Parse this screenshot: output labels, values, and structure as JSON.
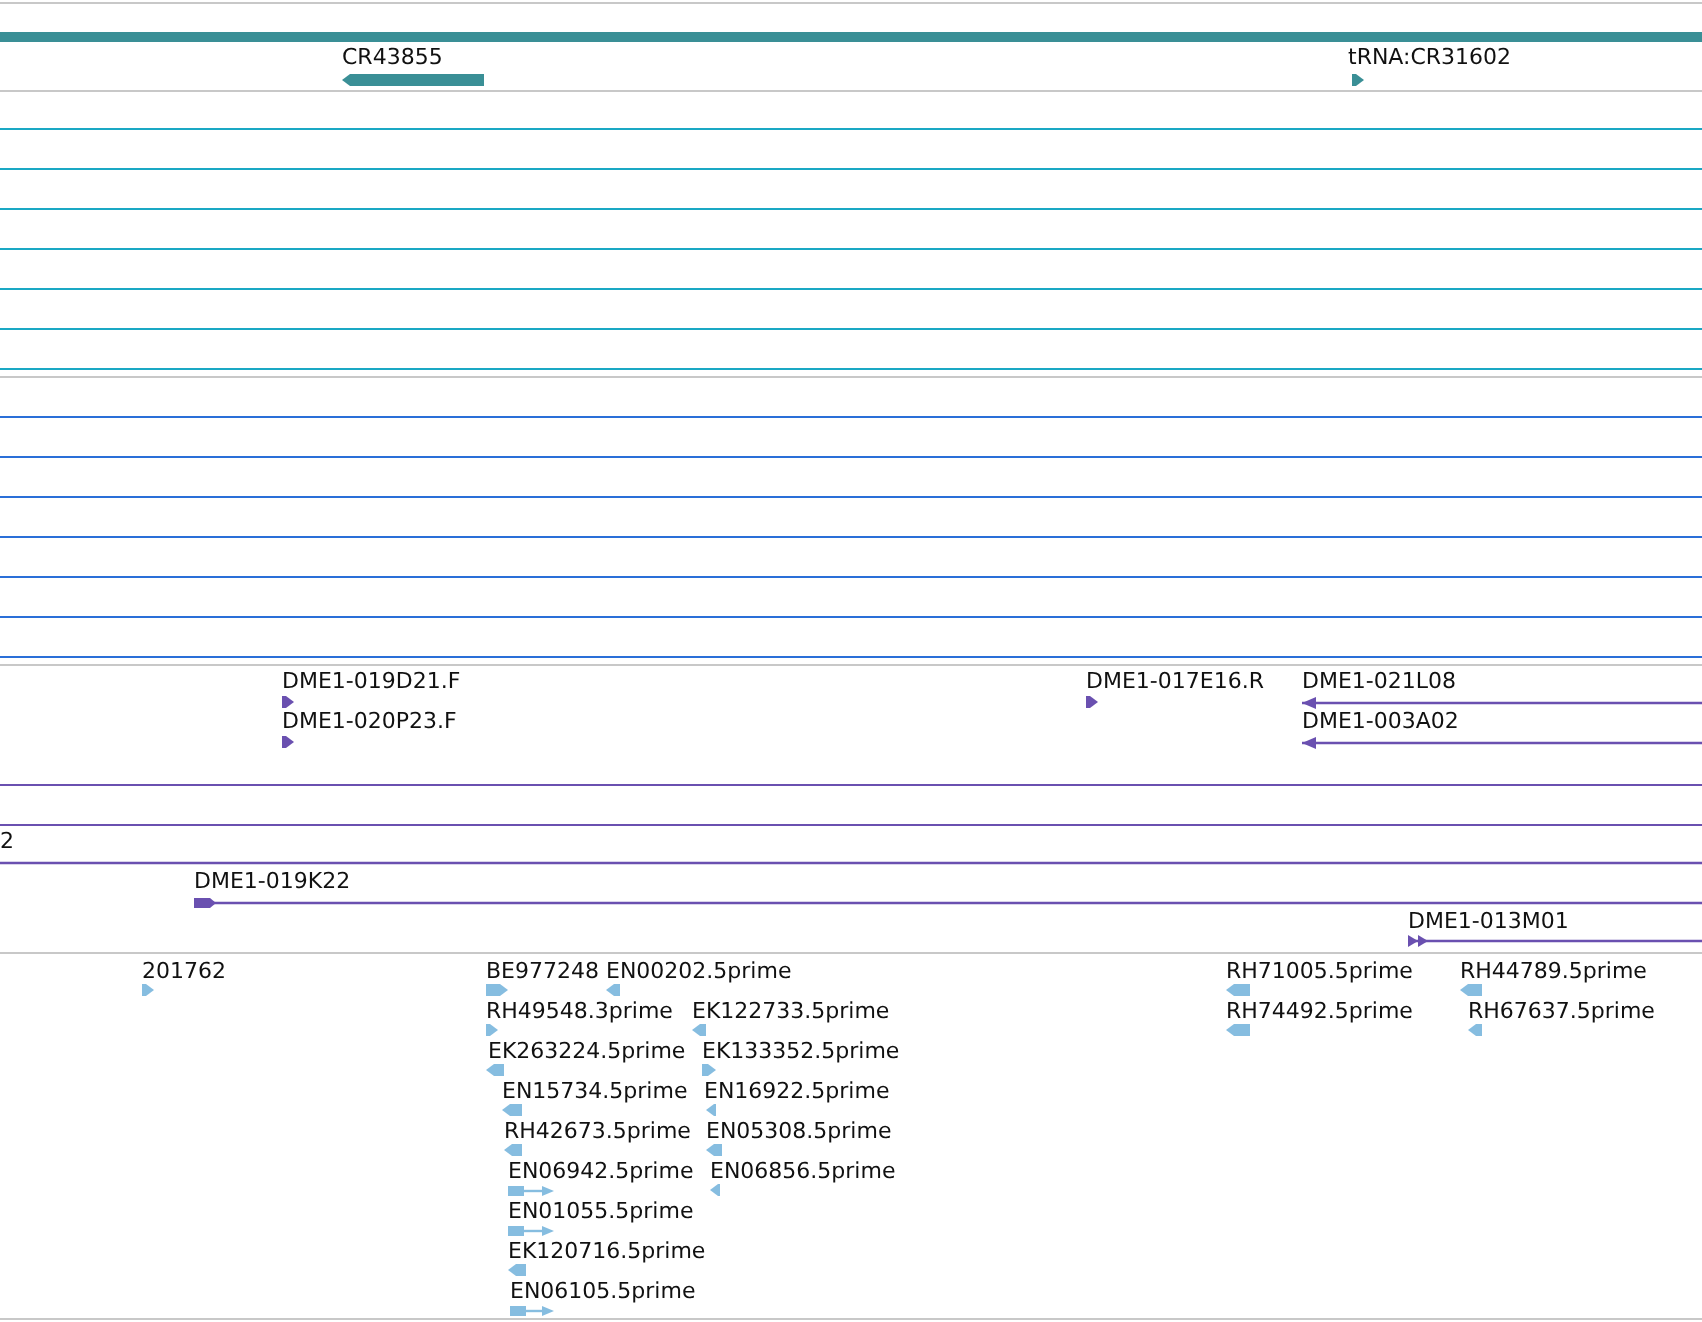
{
  "tracks": [
    {
      "kind": "genes",
      "features": [
        {
          "label": "CR43855",
          "reverse": true
        },
        {
          "label": "tRNA:CR31602",
          "reverse": false
        }
      ]
    },
    {
      "kind": "cyan_lines"
    },
    {
      "kind": "blue_lines"
    },
    {
      "kind": "clones",
      "features": [
        {
          "label": "DME1-019D21.F",
          "reverse": false
        },
        {
          "label": "DME1-020P23.F",
          "reverse": false
        },
        {
          "label": "DME1-017E16.R",
          "reverse": false
        },
        {
          "label": "DME1-021L08",
          "reverse": true
        },
        {
          "label": "DME1-003A02",
          "reverse": true
        },
        {
          "label": "2",
          "reverse": false
        },
        {
          "label": "DME1-019K22",
          "reverse": false
        },
        {
          "label": "DME1-013M01",
          "reverse": false
        }
      ]
    },
    {
      "kind": "ests",
      "features": [
        {
          "label": "201762",
          "reverse": false
        },
        {
          "label": "BE977248",
          "reverse": false
        },
        {
          "label": "EN00202.5prime",
          "reverse": true
        },
        {
          "label": "RH49548.3prime",
          "reverse": false
        },
        {
          "label": "EK122733.5prime",
          "reverse": true
        },
        {
          "label": "EK263224.5prime",
          "reverse": true
        },
        {
          "label": "EK133352.5prime",
          "reverse": false
        },
        {
          "label": "EN15734.5prime",
          "reverse": true
        },
        {
          "label": "EN16922.5prime",
          "reverse": true
        },
        {
          "label": "RH42673.5prime",
          "reverse": true
        },
        {
          "label": "EN05308.5prime",
          "reverse": true
        },
        {
          "label": "EN06942.5prime",
          "reverse": false
        },
        {
          "label": "EN06856.5prime",
          "reverse": true
        },
        {
          "label": "EN01055.5prime",
          "reverse": false
        },
        {
          "label": "EK120716.5prime",
          "reverse": true
        },
        {
          "label": "EN06105.5prime",
          "reverse": false
        },
        {
          "label": "RH71005.5prime",
          "reverse": true
        },
        {
          "label": "RH44789.5prime",
          "reverse": true
        },
        {
          "label": "RH74492.5prime",
          "reverse": true
        },
        {
          "label": "RH67637.5prime",
          "reverse": true
        }
      ]
    }
  ]
}
